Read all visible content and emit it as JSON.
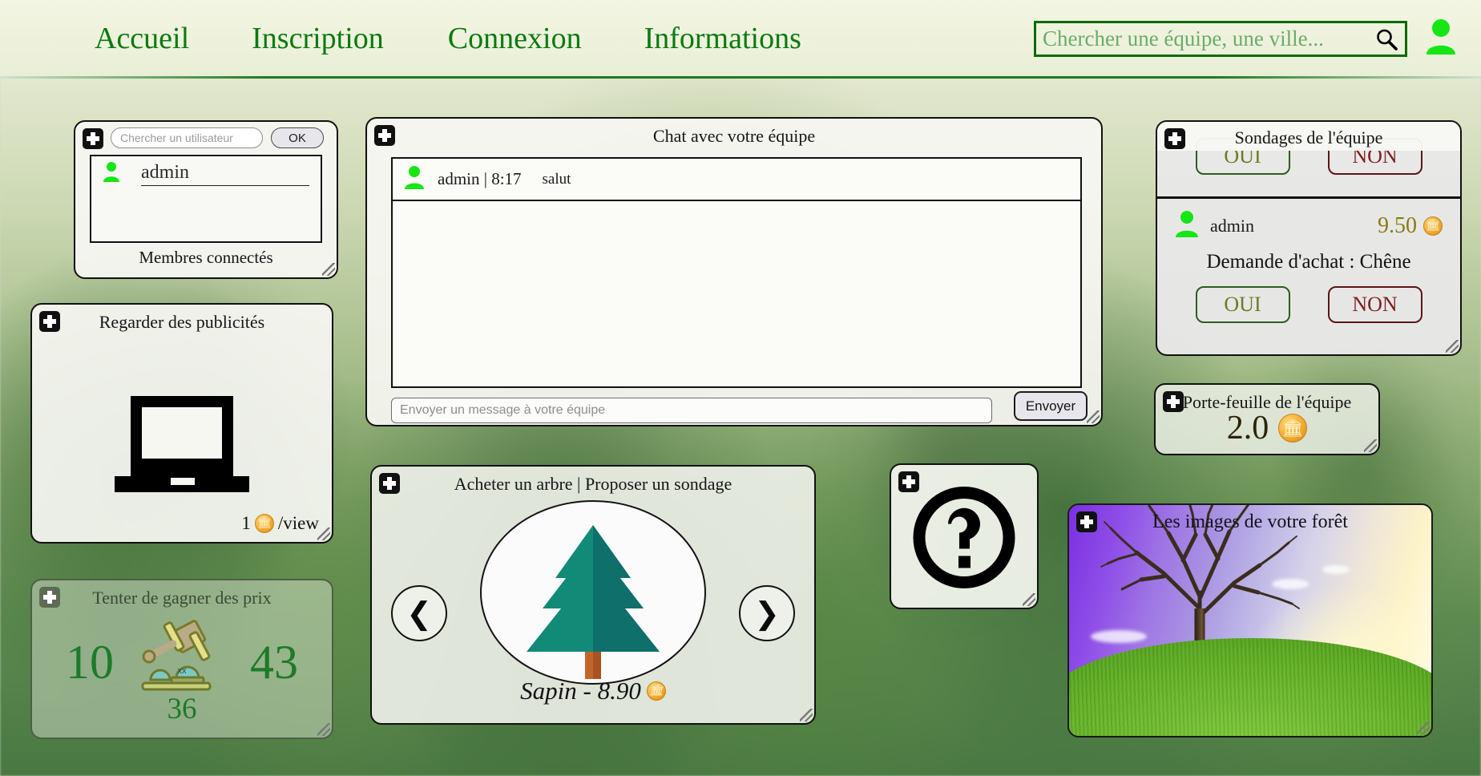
{
  "header": {
    "nav": [
      {
        "label": "Accueil",
        "name": "nav-accueil"
      },
      {
        "label": "Inscription",
        "name": "nav-inscription"
      },
      {
        "label": "Connexion",
        "name": "nav-connexion"
      },
      {
        "label": "Informations",
        "name": "nav-informations"
      }
    ],
    "search_placeholder": "Chercher une équipe, une ville...",
    "search_value": "",
    "search_icon": "magnifier-icon",
    "profile_icon": "user-avatar-icon",
    "accent_color": "#0a7a10"
  },
  "members_panel": {
    "search_placeholder": "Chercher un utilisateur",
    "search_value": "",
    "ok_label": "OK",
    "members": [
      {
        "name": "admin"
      }
    ],
    "footer_label": "Membres connectés",
    "add_icon": "plus-badge-icon",
    "user_icon": "user-icon"
  },
  "ads_panel": {
    "title": "Regarder des publicités",
    "price_value": "1",
    "price_suffix": "/view",
    "laptop_icon": "laptop-icon",
    "coin_icon": "coin-icon"
  },
  "lottery_panel": {
    "title": "Tenter de gagner des prix",
    "left_number": "10",
    "right_number": "43",
    "center_number": "36",
    "auction_icon": "auction-gavel-icon",
    "number_color": "#1e7a2a"
  },
  "chat_panel": {
    "title": "Chat avec votre équipe",
    "messages": [
      {
        "author": "admin",
        "time": "8:17",
        "text": "salut",
        "meta": "admin | 8:17"
      }
    ],
    "input_placeholder": "Envoyer un message à votre équipe",
    "input_value": "",
    "send_label": "Envoyer"
  },
  "shop_panel": {
    "title": "Acheter un arbre | Proposer un sondage",
    "prev_icon": "chevron-left-icon",
    "next_icon": "chevron-right-icon",
    "tree_name": "Sapin",
    "tree_price": "8.90",
    "caption": "Sapin - 8.90",
    "tree_icon": "fir-tree-icon",
    "tree_color": "#0f8a7a"
  },
  "help_panel": {
    "icon": "question-mark-circle-icon"
  },
  "polls_panel": {
    "title": "Sondages de l'équipe",
    "partial_poll": {
      "yes_label": "OUI",
      "no_label": "NON"
    },
    "polls": [
      {
        "user": "admin",
        "amount": "9.50",
        "question": "Demande d'achat : Chêne",
        "yes_label": "OUI",
        "no_label": "NON"
      }
    ],
    "yes_color": "#6f7a1f",
    "no_color": "#7d1f1f"
  },
  "wallet_panel": {
    "title": "Porte-feuille de l'équipe",
    "amount": "2.0",
    "coin_icon": "bank-coin-icon"
  },
  "images_panel": {
    "title": "Les images de votre forêt",
    "photo_alt": "lone-tree-on-green-hill-photo"
  }
}
